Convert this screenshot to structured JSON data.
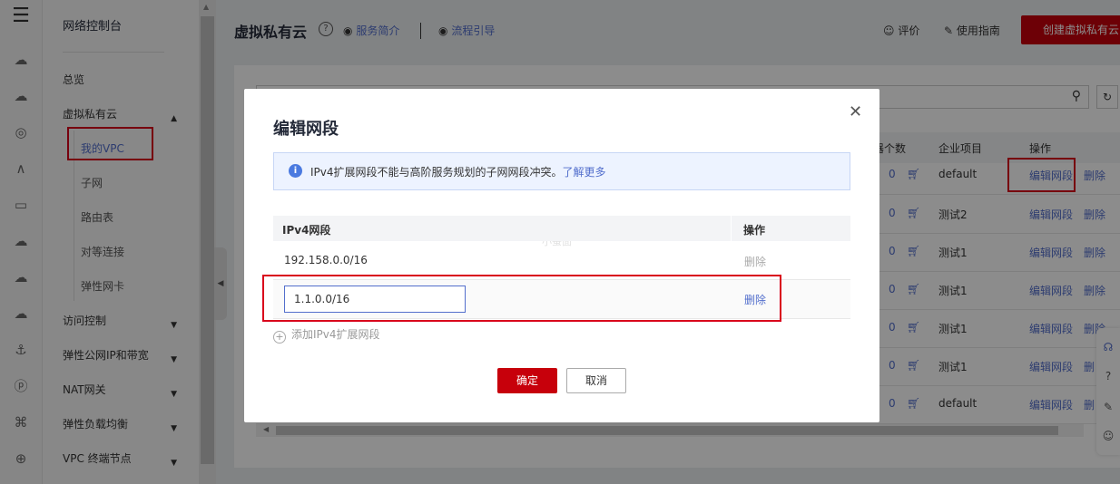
{
  "rail": {
    "icons": [
      "menu-icon",
      "cloud-server-icon",
      "cloud-icon",
      "database-icon",
      "network-icon",
      "storage-icon",
      "cdn-icon",
      "cloud-backup-icon",
      "cloud-sync-icon",
      "ship-icon",
      "ip-icon",
      "cluster-icon",
      "globe-icon"
    ]
  },
  "sidebar": {
    "title": "网络控制台",
    "overview": "总览",
    "vpc_group": "虚拟私有云",
    "sub_items": [
      "我的VPC",
      "子网",
      "路由表",
      "对等连接",
      "弹性网卡"
    ],
    "groups": [
      "访问控制",
      "弹性公网IP和带宽",
      "NAT网关",
      "弹性负载均衡",
      "VPC 终端节点"
    ]
  },
  "header": {
    "title": "虚拟私有云",
    "service_intro": "服务简介",
    "flow_guide": "流程引导",
    "rate": "评价",
    "guide": "使用指南",
    "create_button": "创建虚拟私有云"
  },
  "table": {
    "columns": [
      "器个数",
      "企业项目",
      "操作"
    ],
    "rows": [
      {
        "count": "0",
        "project": "default",
        "edit": "编辑网段",
        "delete": "删除"
      },
      {
        "count": "0",
        "project": "测试2",
        "edit": "编辑网段",
        "delete": "删除"
      },
      {
        "count": "0",
        "project": "测试1",
        "edit": "编辑网段",
        "delete": "删除"
      },
      {
        "count": "0",
        "project": "测试1",
        "edit": "编辑网段",
        "delete": "删除"
      },
      {
        "count": "0",
        "project": "测试1",
        "edit": "编辑网段",
        "delete": "删除"
      },
      {
        "count": "0",
        "project": "测试1",
        "edit": "编辑网段",
        "delete": "删"
      },
      {
        "count": "0",
        "project": "default",
        "edit": "编辑网段",
        "delete": "删"
      }
    ]
  },
  "modal": {
    "title": "编辑网段",
    "info_text": "IPv4扩展网段不能与高阶服务规划的子网网段冲突。",
    "info_link": "了解更多",
    "col_cidr": "IPv4网段",
    "col_action": "操作",
    "row1_cidr": "192.158.0.0/16",
    "row1_delete": "删除",
    "row2_input": "1.1.0.0/16",
    "row2_delete": "删除",
    "add_label": "添加IPv4扩展网段",
    "ok": "确定",
    "cancel": "取消",
    "watermark": "小蚕面"
  },
  "colors": {
    "accent": "#526ecc",
    "primary_red": "#c7000b",
    "highlight": "#d9001b"
  }
}
